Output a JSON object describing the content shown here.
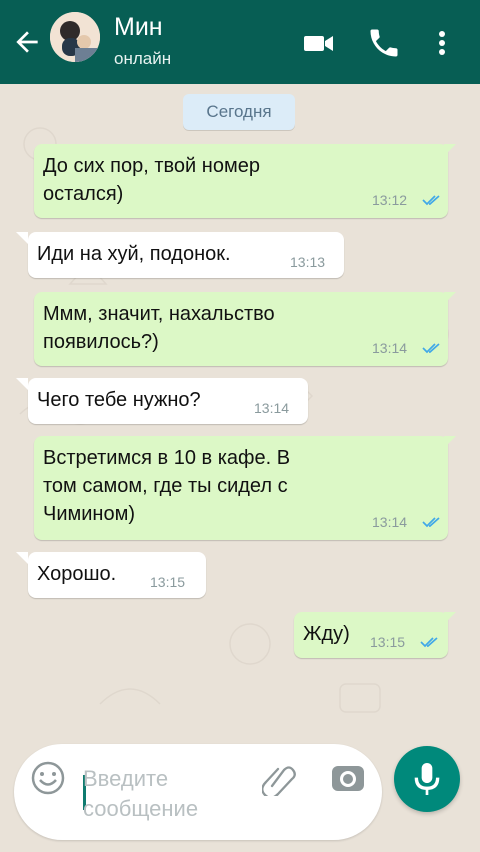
{
  "header": {
    "back_icon": "arrow-left-icon",
    "contact_name": "Мин",
    "status": "онлайн",
    "video_icon": "video-call-icon",
    "call_icon": "phone-icon",
    "menu_icon": "more-vert-icon",
    "bg_color": "#075e54"
  },
  "chat": {
    "date_label": "Сегодня",
    "messages": [
      {
        "direction": "out",
        "text": "До сих пор, твой номер\nостался)",
        "time": "13:12",
        "status": "read"
      },
      {
        "direction": "in",
        "text": "Иди на хуй, подонок.",
        "time": "13:13"
      },
      {
        "direction": "out",
        "text": "Ммм, значит, нахальство\nпоявилось?)",
        "time": "13:14",
        "status": "read"
      },
      {
        "direction": "in",
        "text": "Чего тебе нужно?",
        "time": "13:14"
      },
      {
        "direction": "out",
        "text": "Встретимся в 10 в кафе. В\nтом самом, где ты сидел с\nЧимином)",
        "time": "13:14",
        "status": "read"
      },
      {
        "direction": "in",
        "text": "Хорошо.",
        "time": "13:15"
      },
      {
        "direction": "out",
        "text": "Жду)",
        "time": "13:15",
        "status": "read"
      }
    ]
  },
  "composer": {
    "placeholder": "Введите сообщение",
    "value": "",
    "emoji_icon": "emoji-icon",
    "attach_icon": "paperclip-icon",
    "camera_icon": "camera-icon",
    "mic_icon": "microphone-icon",
    "accent_color": "#00897b"
  }
}
